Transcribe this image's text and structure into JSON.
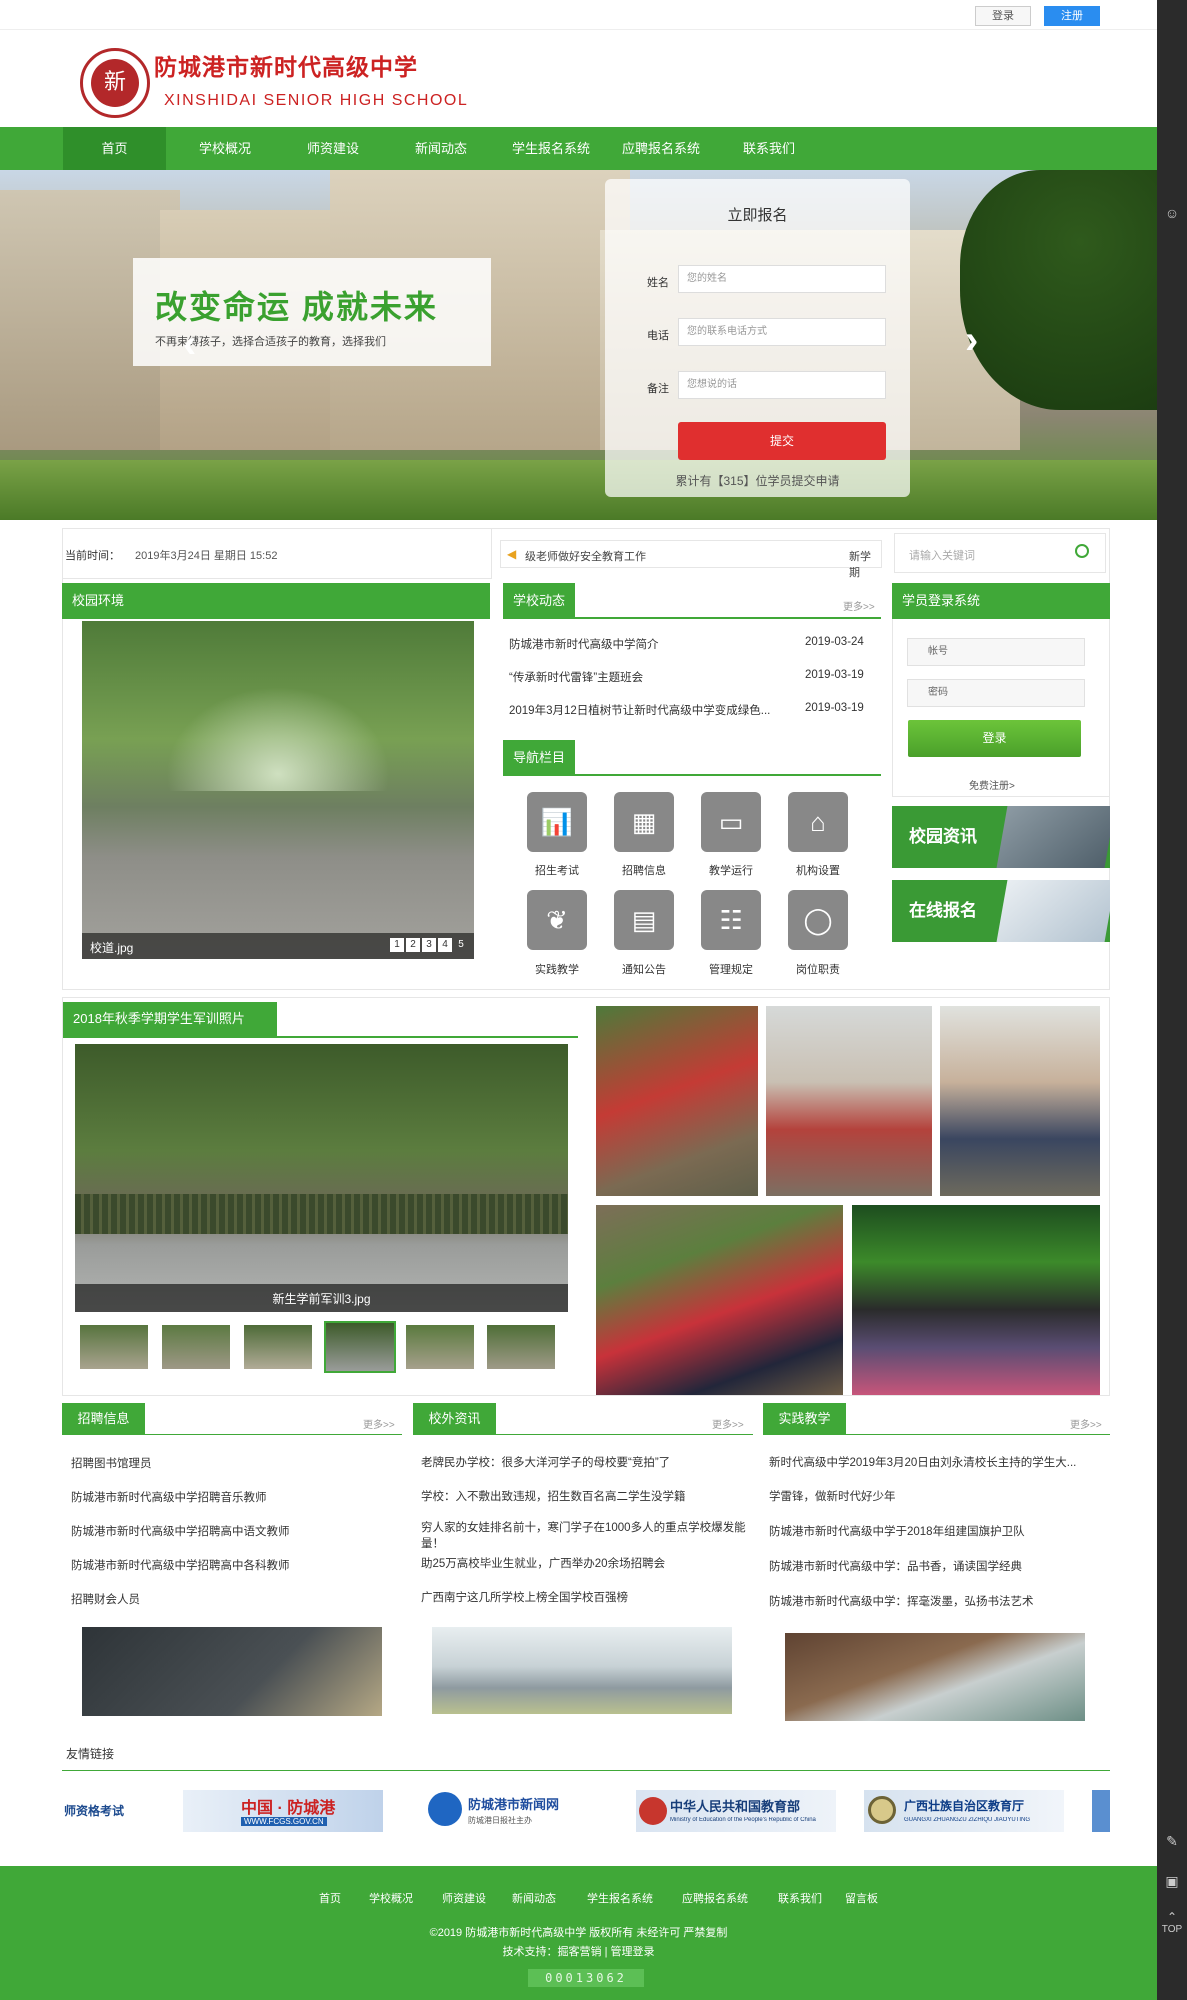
{
  "topbar": {
    "login_label": "登录",
    "register_label": "注册"
  },
  "header": {
    "logo_char": "新",
    "name_cn": "防城港市新时代高级中学",
    "name_en": "XINSHIDAI SENIOR HIGH SCHOOL"
  },
  "nav": {
    "items": [
      {
        "label": "首页"
      },
      {
        "label": "学校概况"
      },
      {
        "label": "师资建设"
      },
      {
        "label": "新闻动态"
      },
      {
        "label": "学生报名系统"
      },
      {
        "label": "应聘报名系统"
      },
      {
        "label": "联系我们"
      }
    ]
  },
  "banner": {
    "slogan": "改变命运  成就未来",
    "sub": "不再束缚孩子，选择合适孩子的教育，选择我们",
    "prev": "‹",
    "next": "›"
  },
  "signup": {
    "title": "立即报名",
    "name_label": "姓名",
    "name_placeholder": "您的姓名",
    "phone_label": "电话",
    "phone_placeholder": "您的联系电话方式",
    "note_label": "备注",
    "note_placeholder": "您想说的话",
    "submit": "提交",
    "count_text": "累计有【315】位学员提交申请"
  },
  "info": {
    "time_label": "当前时间：",
    "time_value": "2019年3月24日 星期日 15:52",
    "ticker": "级老师做好安全教育工作",
    "ticker_tail": "新学期",
    "search_placeholder": "请输入关键词"
  },
  "campus": {
    "title": "校园环境",
    "caption": "校道.jpg",
    "pages": [
      "1",
      "2",
      "3",
      "4",
      "5"
    ]
  },
  "school_news": {
    "title": "学校动态",
    "more": "更多>>",
    "items": [
      {
        "title": "防城港市新时代高级中学简介",
        "date": "2019-03-24"
      },
      {
        "title": "“传承新时代雷锋”主题班会",
        "date": "2019-03-19"
      },
      {
        "title": "2019年3月12日植树节让新时代高级中学变成绿色...",
        "date": "2019-03-19"
      }
    ]
  },
  "guide": {
    "title": "导航栏目",
    "items": [
      {
        "label": "招生考试",
        "icon": "chart-icon"
      },
      {
        "label": "招聘信息",
        "icon": "grid-icon"
      },
      {
        "label": "教学运行",
        "icon": "calendar-icon"
      },
      {
        "label": "机构设置",
        "icon": "building-icon"
      },
      {
        "label": "实践教学",
        "icon": "sprout-icon"
      },
      {
        "label": "通知公告",
        "icon": "document-icon"
      },
      {
        "label": "管理规定",
        "icon": "org-chart-icon"
      },
      {
        "label": "岗位职责",
        "icon": "network-icon"
      }
    ]
  },
  "student_login": {
    "title": "学员登录系统",
    "account_placeholder": "帐号",
    "password_placeholder": "密码",
    "login": "登录",
    "register": "免费注册>"
  },
  "promos": [
    {
      "label": "校园资讯"
    },
    {
      "label": "在线报名"
    }
  ],
  "military": {
    "title": "2018年秋季学期学生军训照片",
    "caption": "新生学前军训3.jpg"
  },
  "recruit": {
    "title": "招聘信息",
    "more": "更多>>",
    "items": [
      "招聘图书馆理员",
      "防城港市新时代高级中学招聘音乐教师",
      "防城港市新时代高级中学招聘高中语文教师",
      "防城港市新时代高级中学招聘高中各科教师",
      "招聘财会人员"
    ]
  },
  "outside": {
    "title": "校外资讯",
    "more": "更多>>",
    "items": [
      "老牌民办学校：很多大洋河学子的母校要“竞拍”了",
      "学校：入不敷出致违规，招生数百名高二学生没学籍",
      "穷人家的女娃排名前十，寒门学子在1000多人的重点学校爆发能量！",
      "助25万高校毕业生就业，广西举办20余场招聘会",
      "广西南宁这几所学校上榜全国学校百强榜"
    ]
  },
  "practice": {
    "title": "实践教学",
    "more": "更多>>",
    "items": [
      "新时代高级中学2019年3月20日由刘永清校长主持的学生大...",
      "学雷锋，做新时代好少年",
      "防城港市新时代高级中学于2018年组建国旗护卫队",
      "防城港市新时代高级中学：品书香，诵读国学经典",
      "防城港市新时代高级中学：挥毫泼墨，弘扬书法艺术"
    ]
  },
  "links": {
    "title": "友情链接",
    "partners": [
      {
        "label": "师资格考试"
      },
      {
        "label": "中国 · 防城港",
        "sub": "WWW.FCGS.GOV.CN"
      },
      {
        "label": "防城港市新闻网",
        "sub": "防城港日报社主办"
      },
      {
        "label": "中华人民共和国教育部",
        "sub": "Ministry of Education of the People's Republic of China"
      },
      {
        "label": "广西壮族自治区教育厅",
        "sub": "GUANGXI ZHUANGZU ZIZHIQU JIAOYUTING"
      }
    ]
  },
  "footer": {
    "links": [
      "首页",
      "学校概况",
      "师资建设",
      "新闻动态",
      "学生报名系统",
      "应聘报名系统",
      "联系我们",
      "留言板"
    ],
    "copyright": "©2019 防城港市新时代高级中学 版权所有 未经许可 严禁复制",
    "support": "技术支持：掘客营销 | 管理登录",
    "counter": "00013062"
  },
  "side": {
    "top_label": "TOP"
  },
  "colors": {
    "brand_green": "#40a838",
    "brand_red": "#c22222",
    "submit_red": "#e02f2f",
    "register_blue": "#2a8df0"
  }
}
